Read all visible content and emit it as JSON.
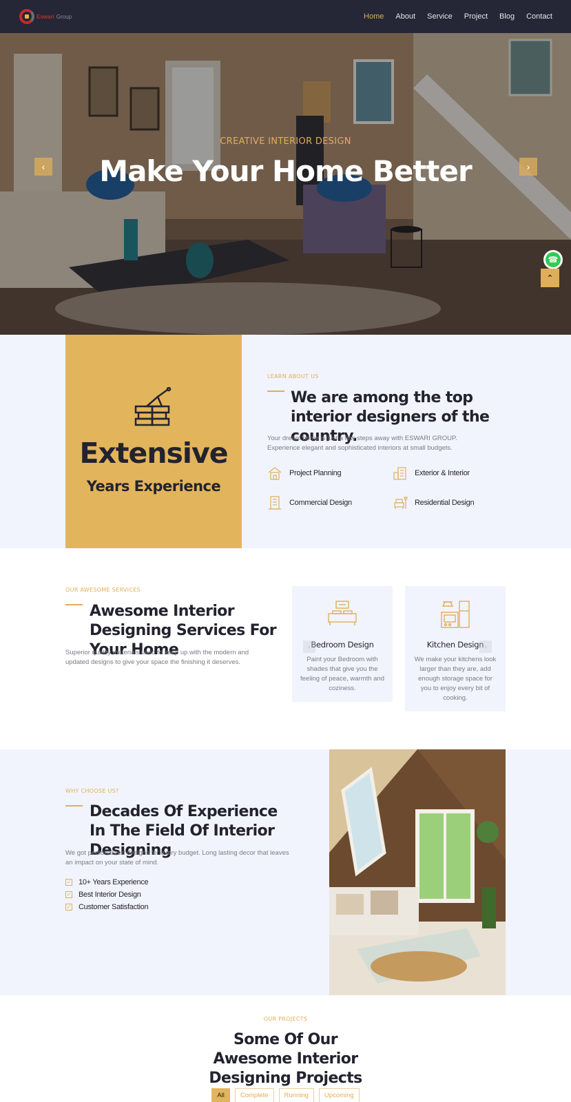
{
  "brand": {
    "name": "Eswari",
    "suffix": "Group"
  },
  "nav": {
    "items": [
      {
        "label": "Home",
        "active": true
      },
      {
        "label": "About",
        "active": false
      },
      {
        "label": "Service",
        "active": false
      },
      {
        "label": "Project",
        "active": false
      },
      {
        "label": "Blog",
        "active": false
      },
      {
        "label": "Contact",
        "active": false
      }
    ]
  },
  "hero": {
    "subtitle": "CREATIVE INTERIOR DESIGN",
    "title": "Make Your Home Better",
    "prev_icon": "chevron-left-icon",
    "next_icon": "chevron-right-icon"
  },
  "floating": {
    "whatsapp_icon": "whatsapp-icon",
    "scroll_top_icon": "double-chevron-up-icon"
  },
  "about": {
    "experience_big": "Extensive",
    "experience_small": "Years Experience",
    "eyebrow": "LEARN ABOUT US",
    "heading": "We are among the top interior designers of the country.",
    "text": "Your dream home is just a few steps away with ESWARI GROUP. Experience elegant and sophisticated interiors at small budgets.",
    "features": [
      "Project Planning",
      "Exterior & Interior",
      "Commercial Design",
      "Residential Design"
    ]
  },
  "services": {
    "eyebrow": "OUR AWESOME SERVICES",
    "heading": "Awesome Interior Designing Services For Your Home",
    "text": "Superior quality materials used to keep up with the modern and updated designs to give your space the finishing it deserves.",
    "cards": [
      {
        "title": "Bedroom Design",
        "text": "Paint your Bedroom with shades that give you the feeling of peace, warmth and coziness."
      },
      {
        "title": "Kitchen Design",
        "text": "We make your kitchens look larger than they are, add enough storage space for you to enjoy every bit of cooking."
      }
    ]
  },
  "why": {
    "eyebrow": "WHY CHOOSE US?",
    "heading": "Decades Of Experience In The Field Of Interior Designing",
    "text": "We got personalized designs for every budget. Long lasting decor that leaves an impact on your state of mind.",
    "checklist": [
      "10+ Years Experience",
      "Best Interior Design",
      "Customer Satisfaction"
    ]
  },
  "projects": {
    "eyebrow": "OUR PROJECTS",
    "heading": "Some Of Our Awesome Interior Designing Projects",
    "filters": [
      {
        "label": "All",
        "active": true
      },
      {
        "label": "Complete",
        "active": false
      },
      {
        "label": "Running",
        "active": false
      },
      {
        "label": "Upcoming",
        "active": false
      }
    ]
  },
  "colors": {
    "accent": "#e0ae58",
    "nav_bg": "#252636",
    "section_bg": "#f1f4fd",
    "heading": "#23232f"
  }
}
